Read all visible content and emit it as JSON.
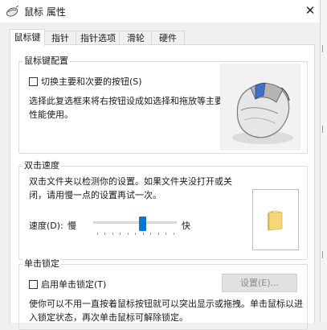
{
  "window": {
    "title": "鼠标 属性",
    "close_glyph": "✕"
  },
  "tabs": [
    {
      "label": "鼠标键",
      "active": true
    },
    {
      "label": "指针",
      "active": false
    },
    {
      "label": "指针选项",
      "active": false
    },
    {
      "label": "滑轮",
      "active": false
    },
    {
      "label": "硬件",
      "active": false
    }
  ],
  "button_config": {
    "legend": "鼠标键配置",
    "swap_label": "切换主要和次要的按钮(S)",
    "swap_checked": false,
    "desc_line1": "选择此复选框来将右按钮设成如选择和拖放等主要",
    "desc_line2": "性能使用。"
  },
  "double_click": {
    "legend": "双击速度",
    "desc_line1": "双击文件夹以检测你的设置。如果文件夹没打开或关",
    "desc_line2": "闭，请用慢一点的设置再试一次。",
    "speed_label": "速度(D):",
    "slow": "慢",
    "fast": "快",
    "speed_level": 0.6
  },
  "click_lock": {
    "legend": "单击锁定",
    "enable_label": "启用单击锁定(T)",
    "enable_checked": false,
    "settings_button": "设置(E)...",
    "desc_line1": "使你可以不用一直按着鼠标按钮就可以突出显示或拖拽。单击鼠标以进",
    "desc_line2": "入锁定状态，再次单击鼠标可解除锁定。"
  },
  "icons": {
    "title": "mouse-cursor-icon",
    "mouse": "mouse-illustration",
    "folder": "folder-icon"
  },
  "colors": {
    "accent": "#0078d7",
    "folder": "#f5d77a"
  }
}
